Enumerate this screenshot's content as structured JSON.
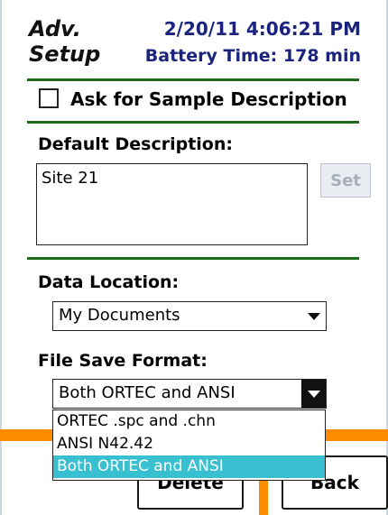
{
  "header": {
    "title_line1": "Adv.",
    "title_line2": "Setup",
    "datetime": "2/20/11 4:06:21 PM",
    "battery": "Battery Time: 178 min"
  },
  "sample_description": {
    "checkbox_label": "Ask for Sample Description",
    "checked": false
  },
  "default_description": {
    "label": "Default Description:",
    "value": "Site 21",
    "set_button": "Set"
  },
  "data_location": {
    "label": "Data Location:",
    "selected": "My Documents"
  },
  "file_save_format": {
    "label": "File Save Format:",
    "selected": "Both ORTEC and ANSI",
    "options": [
      "ORTEC .spc and .chn",
      "ANSI N42.42",
      "Both ORTEC and ANSI"
    ],
    "selected_index": 2
  },
  "buttons": {
    "delete": "Delete",
    "back": "Back"
  },
  "colors": {
    "header_text": "#1a237e",
    "divider": "#1e6b1e",
    "accent_orange": "#ff8c00",
    "selection": "#38bfd0"
  }
}
